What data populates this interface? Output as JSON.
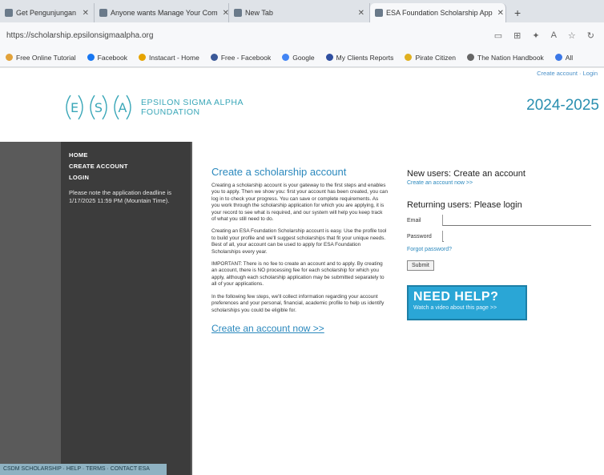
{
  "browser": {
    "tabs": [
      {
        "label": "Get Pengunjungan"
      },
      {
        "label": "Anyone wants Manage Your Com"
      },
      {
        "label": "New Tab"
      },
      {
        "label": "ESA Foundation Scholarship App"
      }
    ],
    "url": "https://scholarship.epsilonsigmaalpha.org",
    "bookmarks": [
      {
        "label": "Free Online Tutorial",
        "color": "#e2a23a"
      },
      {
        "label": "Facebook",
        "color": "#1877f2"
      },
      {
        "label": "Instacart - Home",
        "color": "#e6a400"
      },
      {
        "label": "Free - Facebook",
        "color": "#3b5998"
      },
      {
        "label": "Google",
        "color": "#4285f4"
      },
      {
        "label": "My Clients Reports",
        "color": "#2f4fa0"
      },
      {
        "label": "Pirate Citizen",
        "color": "#e0b020"
      },
      {
        "label": "The Nation Handbook",
        "color": "#666666"
      },
      {
        "label": "All",
        "color": "#3b78e7"
      }
    ]
  },
  "header": {
    "top_links": "Create account · Login",
    "logo_line1": "EPSILON SIGMA ALPHA",
    "logo_line2": "FOUNDATION",
    "year": "2024-2025"
  },
  "sidebar": {
    "links": [
      "HOME",
      "CREATE ACCOUNT",
      "LOGIN"
    ],
    "notice": "Please note the application deadline is 1/17/2025 11:59 PM (Mountain Time)."
  },
  "main": {
    "title": "Create a scholarship account",
    "paragraphs": [
      "Creating a scholarship account is your gateway to the first steps and enables you to apply. Then we show you: first your account has been created, you can log in to check your progress. You can save or complete requirements. As you work through the scholarship application for which you are applying, it is your record to see what is required, and our system will help you keep track of what you still need to do.",
      "Creating an ESA Foundation Scholarship account is easy. Use the profile tool to build your profile and we'll suggest scholarships that fit your unique needs. Best of all, your account can be used to apply for ESA Foundation Scholarships every year.",
      "IMPORTANT: There is no fee to create an account and to apply. By creating an account, there is NO processing fee for each scholarship for which you apply, although each scholarship application may be submitted separately to all of your applications.",
      "In the following few steps, we'll collect information regarding your account preferences and your personal, financial, academic profile to help us identify scholarships you could be eligible for."
    ],
    "cta": "Create an account now >>"
  },
  "login": {
    "new_heading": "New users: Create an account",
    "new_link": "Create an account now >>",
    "return_heading": "Returning users: Please login",
    "email_label": "Email",
    "password_label": "Password",
    "forgot": "Forgot password?",
    "submit": "Submit"
  },
  "help": {
    "title": "NEED HELP?",
    "subtitle": "Watch a video about this page >>"
  },
  "footer": {
    "text": "CSDM SCHOLARSHIP · HELP · TERMS · CONTACT ESA"
  }
}
